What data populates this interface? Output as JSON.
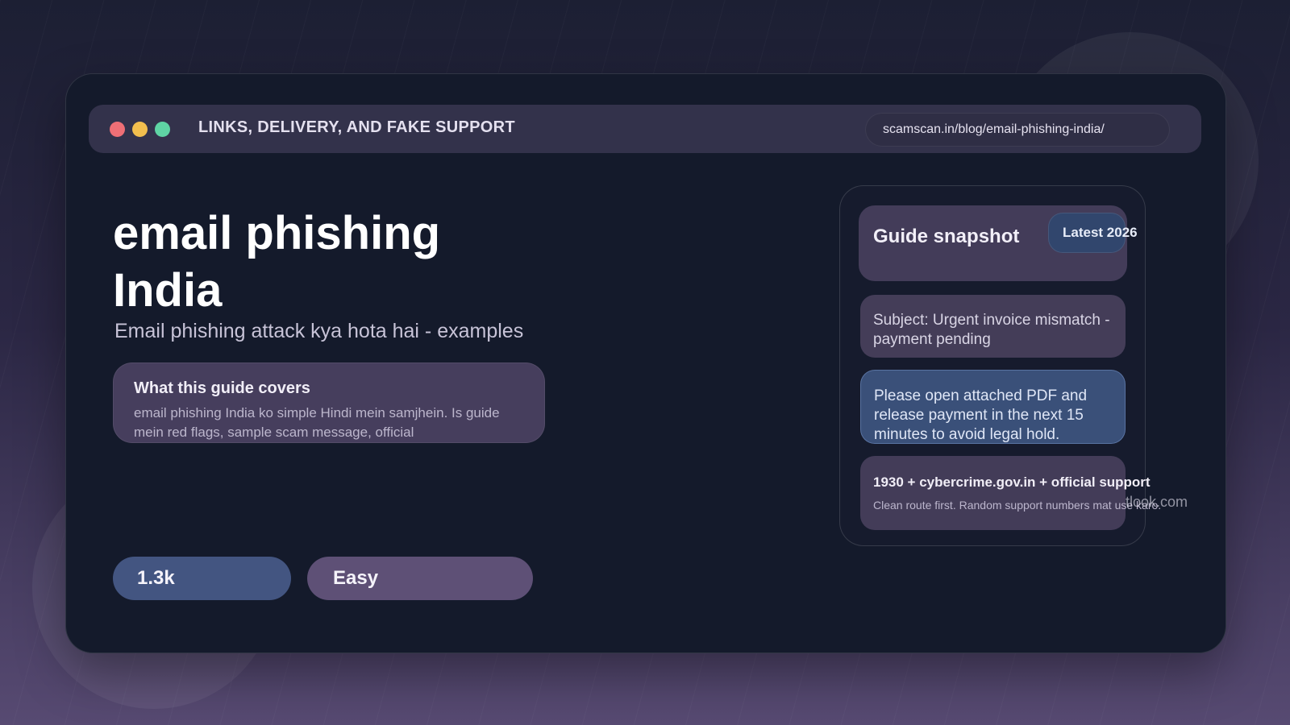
{
  "window": {
    "title": "LINKS, DELIVERY, AND FAKE SUPPORT",
    "url": "scamscan.in/blog/email-phishing-india/"
  },
  "hero": {
    "title": "email phishing India",
    "subtitle": "Email phishing attack kya hota hai - examples"
  },
  "covers": {
    "title": "What this guide covers",
    "text": "email phishing India ko simple Hindi mein samjhein. Is guide mein red flags, sample scam message, official"
  },
  "stats": {
    "views": "1.3k",
    "difficulty": "Easy"
  },
  "snapshot": {
    "title": "Guide snapshot",
    "badge": "Latest 2026",
    "subject": "Subject: Urgent invoice mismatch - payment pending",
    "body": "Please open attached PDF and release payment in the next 15 minutes to avoid legal hold.",
    "support_title": "1930 + cybercrime.gov.in + official support",
    "support_note": "Clean route first. Random support numbers mat use karo.",
    "overflow_text": "tlook.com"
  },
  "colors": {
    "window_bg": "#141a2b",
    "accent_blue": "#435581",
    "accent_purple": "#5e5076",
    "dot_red": "#ef6f76",
    "dot_yellow": "#f2be4e",
    "dot_green": "#5fd4a4"
  }
}
